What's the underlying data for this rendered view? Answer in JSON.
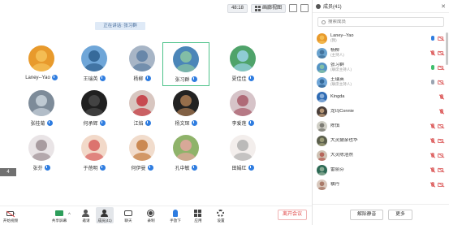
{
  "topbar": {
    "timer": "48:18",
    "view_label": "画廊视图"
  },
  "speaking": "正在讲话: 张习群",
  "tiles": [
    {
      "name": "Laney--Yao",
      "mic_on": true
    },
    {
      "name": "王瑞英",
      "mic_on": true
    },
    {
      "name": "杨柳",
      "mic_on": true
    },
    {
      "name": "张习群",
      "mic_on": true,
      "active": true
    },
    {
      "name": "夏佳佳",
      "mic_on": true
    },
    {
      "name": "张桂菊",
      "mic_on": true
    },
    {
      "name": "何承辉",
      "mic_on": true
    },
    {
      "name": "江焰",
      "mic_on": true
    },
    {
      "name": "杨文琛",
      "mic_on": true
    },
    {
      "name": "李爱莲",
      "mic_on": true
    },
    {
      "name": "张芬",
      "mic_on": true
    },
    {
      "name": "于蓓明",
      "mic_on": true
    },
    {
      "name": "何伊曼",
      "mic_on": true
    },
    {
      "name": "孔中敏",
      "mic_on": true
    },
    {
      "name": "田娟红",
      "mic_on": true
    }
  ],
  "side_tab": "4",
  "toolbar": {
    "items": [
      {
        "label": "开始视频",
        "icon": "camera-icon"
      },
      {
        "label": "共享屏幕",
        "icon": "share-screen-icon"
      },
      {
        "label": "邀请",
        "icon": "invite-icon"
      },
      {
        "label": "成员(41)",
        "icon": "members-icon",
        "selected": true
      },
      {
        "label": "聊天",
        "icon": "chat-icon"
      },
      {
        "label": "录制",
        "icon": "record-icon"
      },
      {
        "label": "手放下",
        "icon": "hand-icon"
      },
      {
        "label": "应用",
        "icon": "apps-icon"
      },
      {
        "label": "设置",
        "icon": "settings-icon"
      }
    ],
    "leave": "离开会议"
  },
  "panel": {
    "title": "成员(41)",
    "search_placeholder": "搜索成员",
    "members": [
      {
        "name": "Laney--Yao",
        "role": "(我)",
        "mic": "blue",
        "cam": "off"
      },
      {
        "name": "杨柳",
        "role": "(主持人)",
        "mic": "off",
        "cam": "off"
      },
      {
        "name": "张习群",
        "role": "(联席主持人)",
        "mic": "green",
        "cam": "off"
      },
      {
        "name": "王瑞英",
        "role": "(联席主持人)",
        "mic": "gray",
        "cam": "off"
      },
      {
        "name": "Kingda",
        "role": "",
        "mic": "off",
        "cam": "none"
      },
      {
        "name": "龙玛Connie",
        "role": "",
        "mic": "off",
        "cam": "none"
      },
      {
        "name": "陈慎",
        "role": "",
        "mic": "off",
        "cam": "off"
      },
      {
        "name": "大灵鼓余也华",
        "role": "",
        "mic": "off",
        "cam": "off"
      },
      {
        "name": "大灵陈浩然",
        "role": "",
        "mic": "off",
        "cam": "off"
      },
      {
        "name": "雷丽芬",
        "role": "",
        "mic": "off",
        "cam": "off"
      },
      {
        "name": "横丹",
        "role": "",
        "mic": "off",
        "cam": "off"
      }
    ],
    "mute_all": "解除静音",
    "more": "更多"
  },
  "colors": {
    "accent": "#2f7de0",
    "active_border": "#4dc28a",
    "leave": "#e04b4b"
  }
}
